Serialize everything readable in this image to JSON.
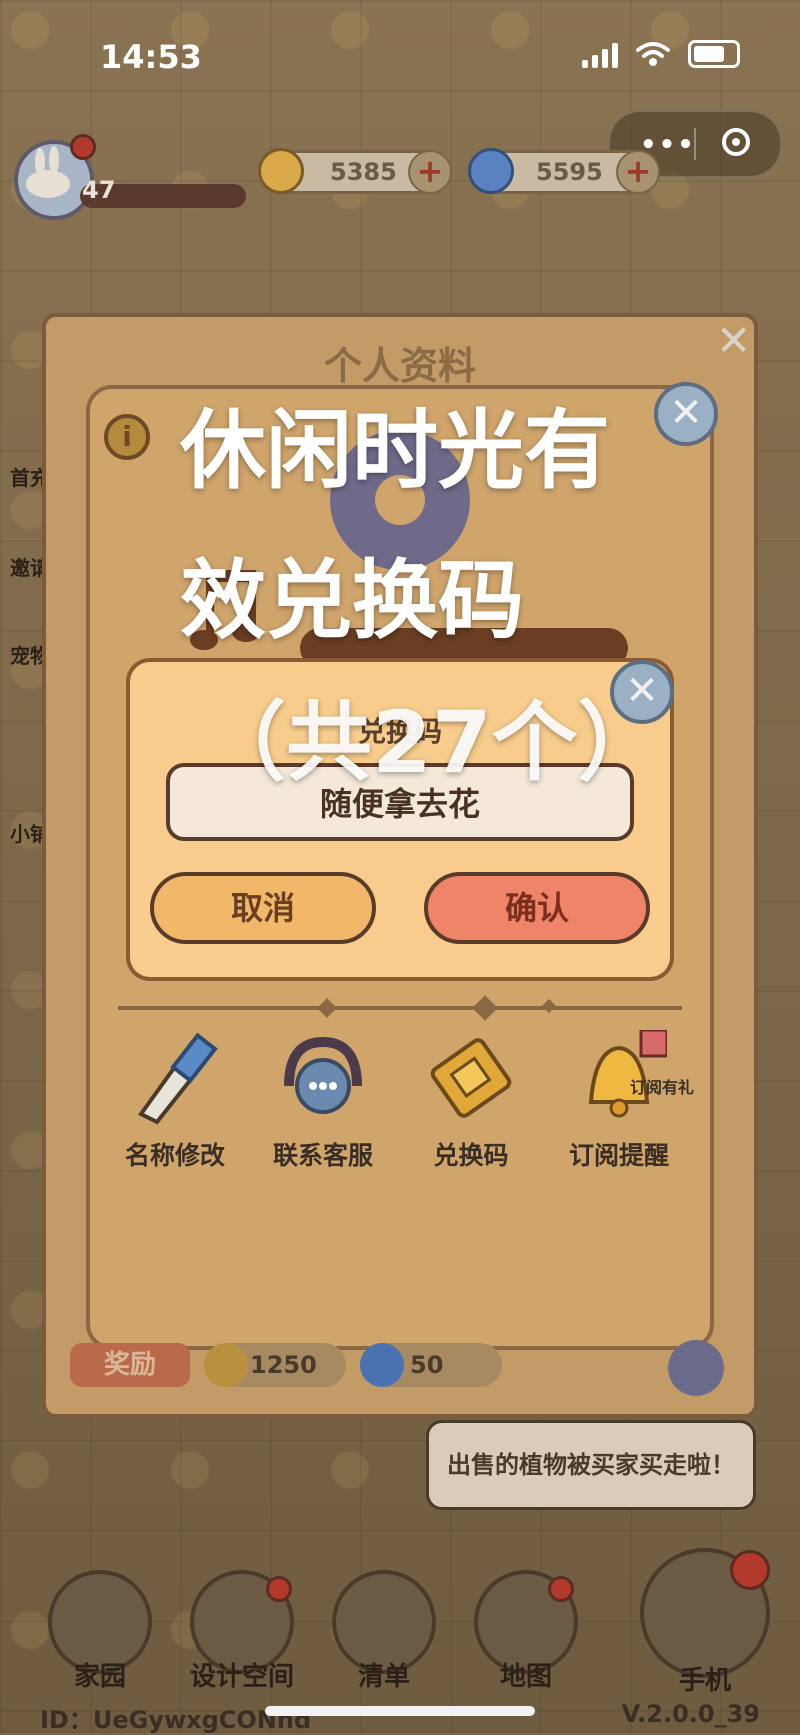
{
  "status_bar": {
    "time": "14:53"
  },
  "hud": {
    "level": "47",
    "coins": "5385",
    "gems": "5595"
  },
  "side_menu": [
    "首充",
    "邀请",
    "宠物",
    "小铺"
  ],
  "profile_panel": {
    "title": "个人资料",
    "quick_actions": [
      {
        "label": "名称修改",
        "icon": "pencil-icon"
      },
      {
        "label": "联系客服",
        "icon": "headset-icon"
      },
      {
        "label": "兑换码",
        "icon": "ticket-icon"
      },
      {
        "label": "订阅提醒",
        "icon": "bell-icon",
        "badge": "订阅有礼"
      }
    ],
    "reward": {
      "label": "奖励",
      "coins": "1250",
      "gems": "50"
    }
  },
  "redeem_dialog": {
    "title": "兑换码",
    "code_value": "随便拿去花",
    "cancel_label": "取消",
    "confirm_label": "确认"
  },
  "overlay_caption": {
    "line1": "休闲时光有",
    "line2": "效兑换码",
    "line3": "（共27个）"
  },
  "notice": "出售的植物被买家买走啦！",
  "bottom_nav": [
    {
      "label": "家园",
      "icon": "house-icon"
    },
    {
      "label": "设计空间",
      "icon": "design-icon"
    },
    {
      "label": "清单",
      "icon": "list-icon"
    },
    {
      "label": "地图",
      "icon": "map-pin-icon"
    },
    {
      "label": "手机",
      "icon": "phone-icon"
    }
  ],
  "footer": {
    "id": "ID：UeGywxgCONnd",
    "version": "V.2.0.0_39"
  },
  "colors": {
    "accent_confirm": "#ef8468",
    "accent_cancel": "#f0b868",
    "panel": "#d0a56c"
  }
}
